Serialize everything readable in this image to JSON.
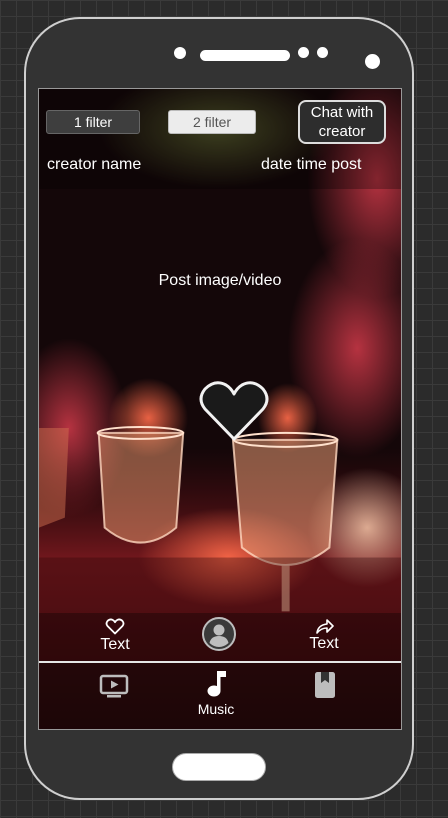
{
  "filters": [
    "1 filter",
    "2 filter"
  ],
  "chat_button": "Chat with creator",
  "post": {
    "creator_name": "creator name",
    "date_time": "date time post",
    "media_placeholder": "Post image/video"
  },
  "actions": {
    "like_text": "Text",
    "share_text": "Text"
  },
  "nav": {
    "music_label": "Music"
  },
  "icons": {
    "like": "heart-outline-icon",
    "big_like": "heart-icon",
    "avatar": "person-icon",
    "share": "share-arrow-icon",
    "video": "tv-play-icon",
    "music": "music-note-icon",
    "book": "bookmark-book-icon"
  },
  "colors": {
    "phone_body": "#333333",
    "active": "#ffffff",
    "inactive": "#bdbdbd"
  }
}
